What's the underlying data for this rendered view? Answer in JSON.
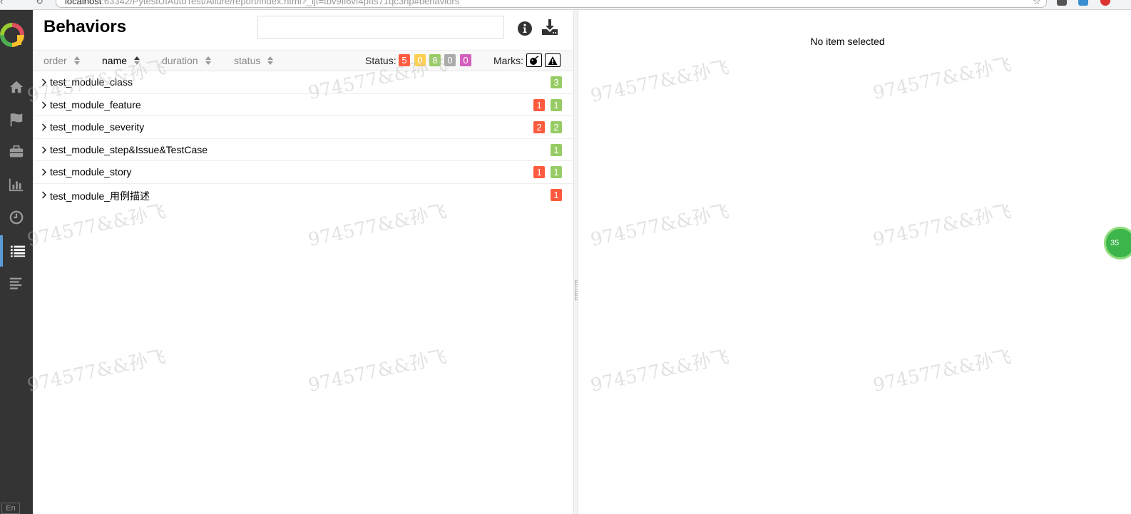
{
  "browser": {
    "url_host": "localhost",
    "url_rest": ":63342/PytestUIAutoTest/Allure/report/index.html?_ijt=tbv9fl6vf4pfts71qc3np#behaviors"
  },
  "sidebar": {
    "lang_label": "En",
    "items": [
      {
        "name": "overview",
        "icon": "home-icon"
      },
      {
        "name": "categories",
        "icon": "flag-icon"
      },
      {
        "name": "suites",
        "icon": "briefcase-icon"
      },
      {
        "name": "graphs",
        "icon": "bar-chart-icon"
      },
      {
        "name": "timeline",
        "icon": "clock-icon"
      },
      {
        "name": "behaviors",
        "icon": "list-icon",
        "active": true
      },
      {
        "name": "packages",
        "icon": "align-left-icon"
      }
    ]
  },
  "header": {
    "title": "Behaviors",
    "search_placeholder": ""
  },
  "sort": {
    "order": "order",
    "name": "name",
    "duration": "duration",
    "status": "status"
  },
  "status_filter": {
    "label": "Status:",
    "failed": "5",
    "broken": "0",
    "passed": "8",
    "skipped": "0",
    "unknown": "0",
    "colors": {
      "failed": "#fd5a3e",
      "broken": "#ffd050",
      "passed": "#97cc64",
      "skipped": "#aaaaaa",
      "unknown": "#d35ebe"
    }
  },
  "marks": {
    "label": "Marks:",
    "flaky_icon": "bomb-icon",
    "new_failed_icon": "warning-icon"
  },
  "tree": {
    "rows": [
      {
        "name": "test_module_class",
        "failed": "",
        "passed": "3"
      },
      {
        "name": "test_module_feature",
        "failed": "1",
        "passed": "1"
      },
      {
        "name": "test_module_severity",
        "failed": "2",
        "passed": "2"
      },
      {
        "name": "test_module_step&Issue&TestCase",
        "failed": "",
        "passed": "1"
      },
      {
        "name": "test_module_story",
        "failed": "1",
        "passed": "1"
      },
      {
        "name": "test_module_用例描述",
        "failed": "1",
        "passed": ""
      }
    ]
  },
  "detail": {
    "empty_text": "No item selected"
  },
  "float_bubble": "35",
  "watermark": "974577&&孙飞"
}
